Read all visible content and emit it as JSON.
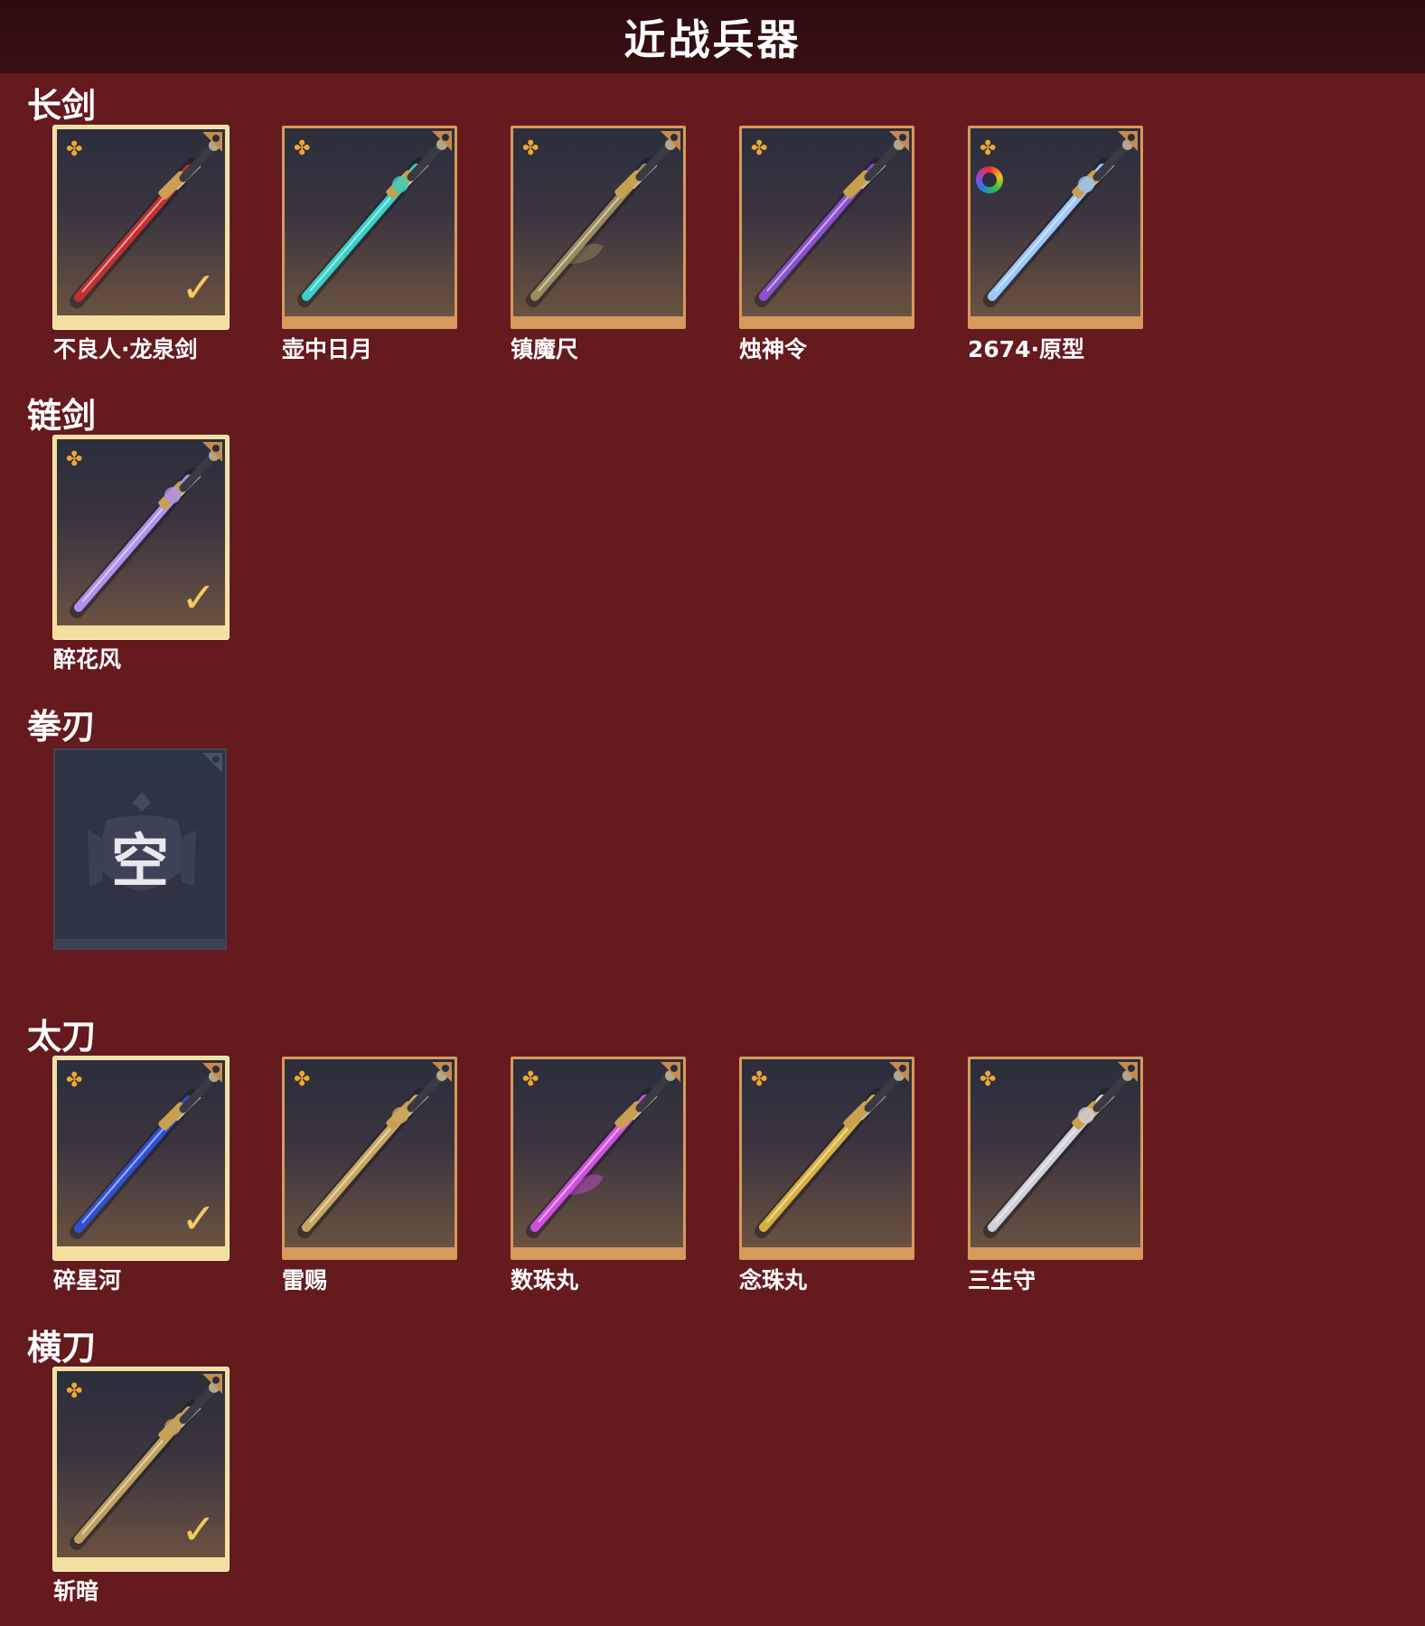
{
  "page": {
    "title": "近战兵器"
  },
  "categories": [
    {
      "key": "longsword",
      "label": "长剑",
      "items": [
        {
          "name": "不良人·龙泉剑",
          "equipped": true,
          "rarity_icon": "rarity-flower-icon",
          "color": "#c23030"
        },
        {
          "name": "壶中日月",
          "equipped": false,
          "rarity_icon": "rarity-flower-icon",
          "color": "#38d0c8"
        },
        {
          "name": "镇魔尺",
          "equipped": false,
          "rarity_icon": "rarity-flower-icon",
          "color": "#9a8c5c"
        },
        {
          "name": "烛神令",
          "equipped": false,
          "rarity_icon": "rarity-flower-icon",
          "color": "#8a50d0"
        },
        {
          "name": "2674·原型",
          "equipped": false,
          "rarity_icon": "rarity-flower-icon",
          "color": "#9cc8ff",
          "dye_icon": "color-wheel-icon"
        }
      ]
    },
    {
      "key": "chainsword",
      "label": "链剑",
      "items": [
        {
          "name": "醉花风",
          "equipped": true,
          "rarity_icon": "rarity-flower-icon",
          "color": "#b090f0"
        }
      ]
    },
    {
      "key": "fistblade",
      "label": "拳刃",
      "items": [],
      "empty_text": "空"
    },
    {
      "key": "katana",
      "label": "太刀",
      "items": [
        {
          "name": "碎星河",
          "equipped": true,
          "rarity_icon": "rarity-flower-icon",
          "color": "#3050d8"
        },
        {
          "name": "雷赐",
          "equipped": false,
          "rarity_icon": "rarity-flower-icon",
          "color": "#c8a860"
        },
        {
          "name": "数珠丸",
          "equipped": false,
          "rarity_icon": "rarity-flower-icon",
          "color": "#d050e0"
        },
        {
          "name": "念珠丸",
          "equipped": false,
          "rarity_icon": "rarity-flower-icon",
          "color": "#d8b040"
        },
        {
          "name": "三生守",
          "equipped": false,
          "rarity_icon": "rarity-flower-icon",
          "color": "#d0d0d8"
        }
      ]
    },
    {
      "key": "saber",
      "label": "横刀",
      "items": [
        {
          "name": "斩暗",
          "equipped": true,
          "rarity_icon": "rarity-flower-icon",
          "color": "#c0a060"
        }
      ]
    }
  ],
  "colors": {
    "background": "#651a1e",
    "title_bar": "#2d0c0e",
    "card_frame": "#d59a5c",
    "equipped_frame": "#f5dfa0",
    "checkmark": "#f4c862",
    "rarity": "#f0a830"
  }
}
